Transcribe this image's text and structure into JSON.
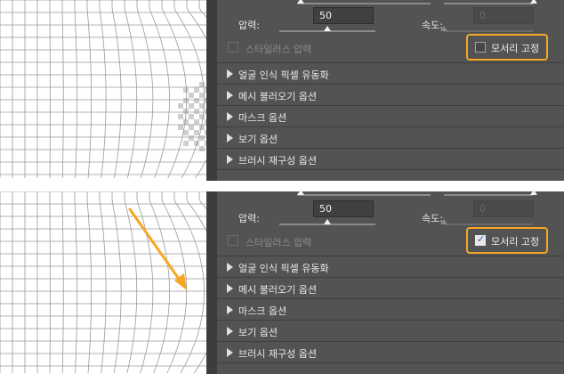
{
  "colors": {
    "panel_bg": "#535353",
    "highlight": "#f5a623",
    "arrow": "#f5a623"
  },
  "top": {
    "pressure_label": "압력:",
    "pressure_value": "50",
    "pressure_level": 0.5,
    "speed_label": "속도:",
    "speed_value": "0",
    "speed_level": 0.0,
    "stylus_label": "스타일러스 압력",
    "pin_edges_label": "모서리 고정",
    "pin_edges_checked": false,
    "sections": [
      "얼굴 인식 픽셀 유동화",
      "메시 불러오기 옵션",
      "마스크 옵션",
      "보기 옵션",
      "브러시 재구성 옵션"
    ]
  },
  "bottom": {
    "pressure_label": "압력:",
    "pressure_value": "50",
    "pressure_level": 0.5,
    "speed_label": "속도:",
    "speed_value": "0",
    "speed_level": 0.0,
    "stylus_label": "스타일러스 압력",
    "pin_edges_label": "모서리 고정",
    "pin_edges_checked": true,
    "check_mark": "✓",
    "sections": [
      "얼굴 인식 픽셀 유동화",
      "메시 불러오기 옵션",
      "마스크 옵션",
      "보기 옵션",
      "브러시 재구성 옵션"
    ]
  },
  "icons": {
    "section_arrow": "triangle-right-icon",
    "annotation": "arrow-icon"
  }
}
